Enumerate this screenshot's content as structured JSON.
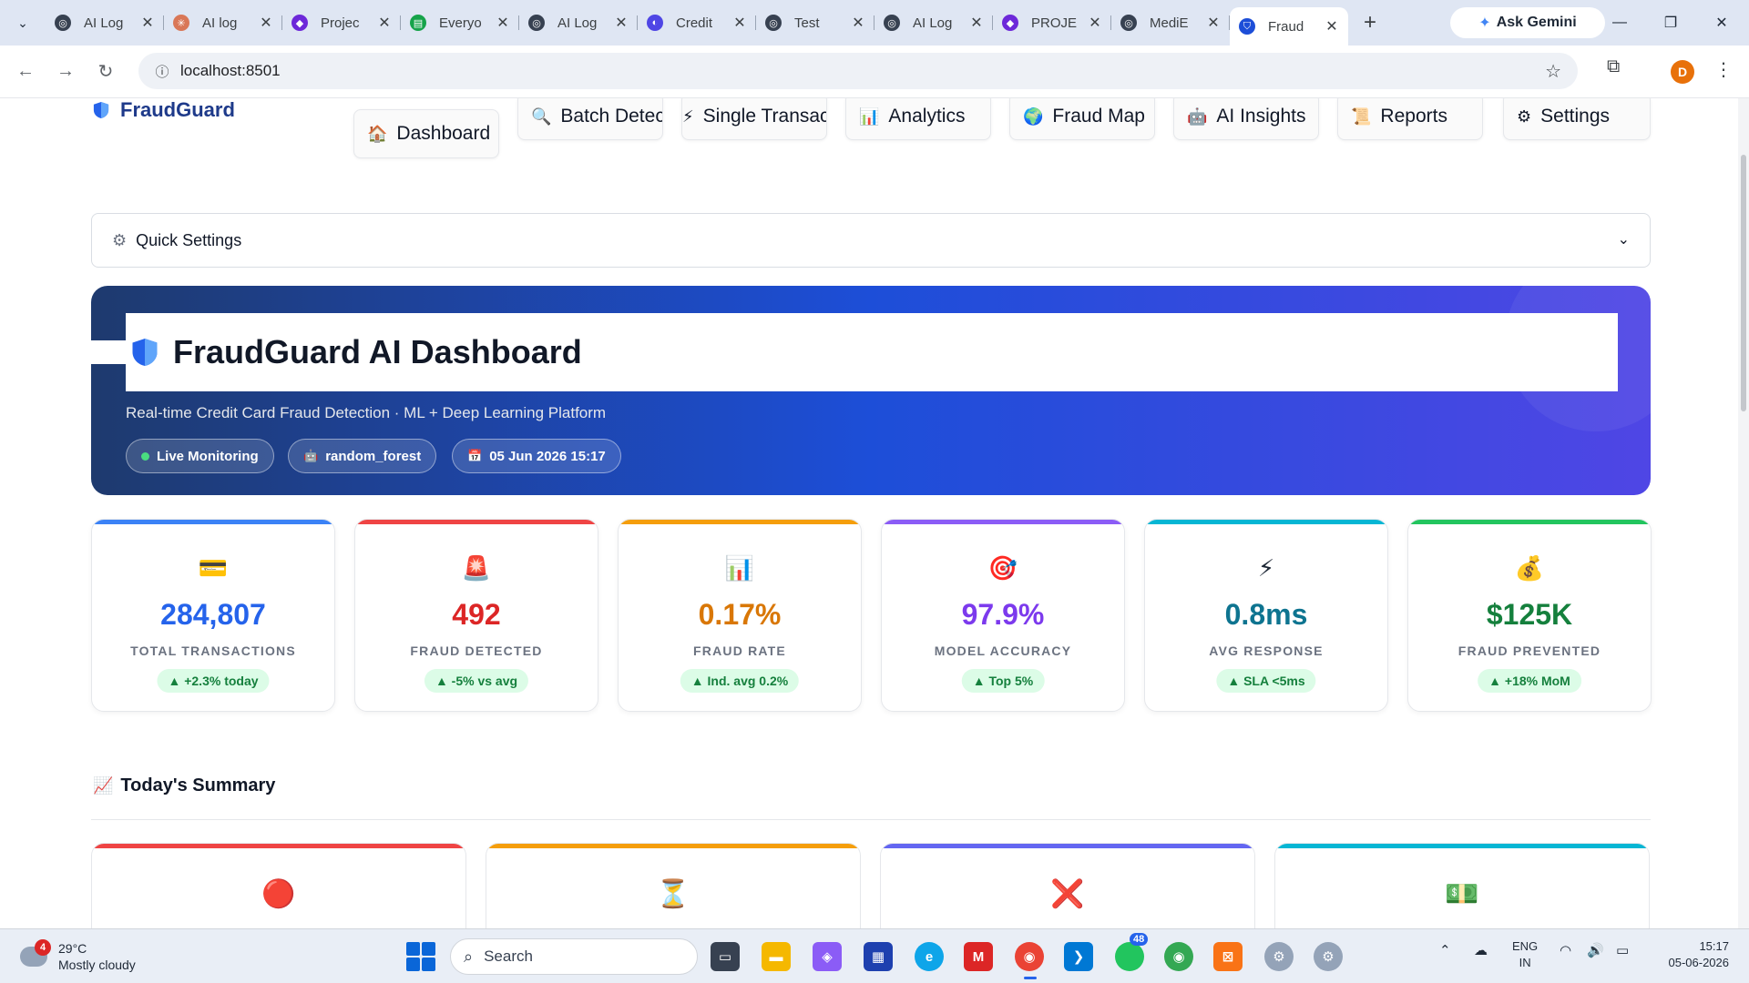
{
  "browser": {
    "tabs": [
      {
        "title": "AI Log",
        "color": "#374151",
        "glyph": "◎"
      },
      {
        "title": "AI log",
        "color": "#d97757",
        "glyph": "✳"
      },
      {
        "title": "Projec",
        "color": "#6d28d9",
        "glyph": "◆"
      },
      {
        "title": "Everyo",
        "color": "#16a34a",
        "glyph": "▤"
      },
      {
        "title": "AI Log",
        "color": "#374151",
        "glyph": "◎"
      },
      {
        "title": "Credit",
        "color": "#4f46e5",
        "glyph": "◐"
      },
      {
        "title": "Test",
        "color": "#374151",
        "glyph": "◎"
      },
      {
        "title": "AI Log",
        "color": "#374151",
        "glyph": "◎"
      },
      {
        "title": "PROJE",
        "color": "#6d28d9",
        "glyph": "◆"
      },
      {
        "title": "MediE",
        "color": "#374151",
        "glyph": "◎"
      },
      {
        "title": "Fraud",
        "color": "#1d4ed8",
        "glyph": "⛉",
        "active": true
      }
    ],
    "ask_gemini": "Ask Gemini",
    "url": "localhost:8501",
    "profile_initial": "D"
  },
  "app": {
    "brand": "FraudGuard",
    "nav": [
      {
        "icon": "🏠",
        "label": "Dashboard"
      },
      {
        "icon": "🔍",
        "label": "Batch Detectic"
      },
      {
        "icon": "⚡",
        "label": "Single Transactior"
      },
      {
        "icon": "📊",
        "label": "Analytics"
      },
      {
        "icon": "🌍",
        "label": "Fraud Map"
      },
      {
        "icon": "🤖",
        "label": "AI Insights"
      },
      {
        "icon": "📜",
        "label": "Reports"
      },
      {
        "icon": "⚙",
        "label": "Settings"
      }
    ],
    "quick_settings": "Quick Settings",
    "hero": {
      "title": "FraudGuard AI Dashboard",
      "subtitle": "Real-time Credit Card Fraud Detection · ML + Deep Learning Platform",
      "pills": {
        "status": "Live Monitoring",
        "model": "random_forest",
        "date": "05 Jun 2026 15:17"
      }
    },
    "stats": [
      {
        "icon": "💳",
        "value": "284,807",
        "label": "TOTAL TRANSACTIONS",
        "delta": "▲ +2.3% today",
        "color": "#2563eb",
        "bar": "#3b82f6"
      },
      {
        "icon": "🚨",
        "value": "492",
        "label": "FRAUD DETECTED",
        "delta": "▲ -5% vs avg",
        "color": "#dc2626",
        "bar": "#ef4444"
      },
      {
        "icon": "📊",
        "value": "0.17%",
        "label": "FRAUD RATE",
        "delta": "▲ Ind. avg 0.2%",
        "color": "#d97706",
        "bar": "#f59e0b"
      },
      {
        "icon": "🎯",
        "value": "97.9%",
        "label": "MODEL ACCURACY",
        "delta": "▲ Top 5%",
        "color": "#7c3aed",
        "bar": "#8b5cf6"
      },
      {
        "icon": "⚡",
        "value": "0.8ms",
        "label": "AVG RESPONSE",
        "delta": "▲ SLA <5ms",
        "color": "#0e7490",
        "bar": "#06b6d4"
      },
      {
        "icon": "💰",
        "value": "$125K",
        "label": "FRAUD PREVENTED",
        "delta": "▲ +18% MoM",
        "color": "#15803d",
        "bar": "#22c55e"
      }
    ],
    "summary": {
      "title": "Today's Summary",
      "icon": "📈",
      "cards": [
        {
          "icon": "🔴",
          "bar": "#ef4444",
          "peek": "#dc2626"
        },
        {
          "icon": "⏳",
          "bar": "#f59e0b",
          "peek": "#d97706"
        },
        {
          "icon": "❌",
          "bar": "#6366f1",
          "peek": "#4f46e5"
        },
        {
          "icon": "💵",
          "bar": "#06b6d4",
          "peek": "#0e7490"
        }
      ]
    }
  },
  "taskbar": {
    "weather_temp": "29°C",
    "weather_desc": "Mostly cloudy",
    "weather_badge": "4",
    "search": "Search",
    "whatsapp_badge": "48",
    "lang_line1": "ENG",
    "lang_line2": "IN",
    "time": "15:17",
    "date": "05-06-2026"
  }
}
